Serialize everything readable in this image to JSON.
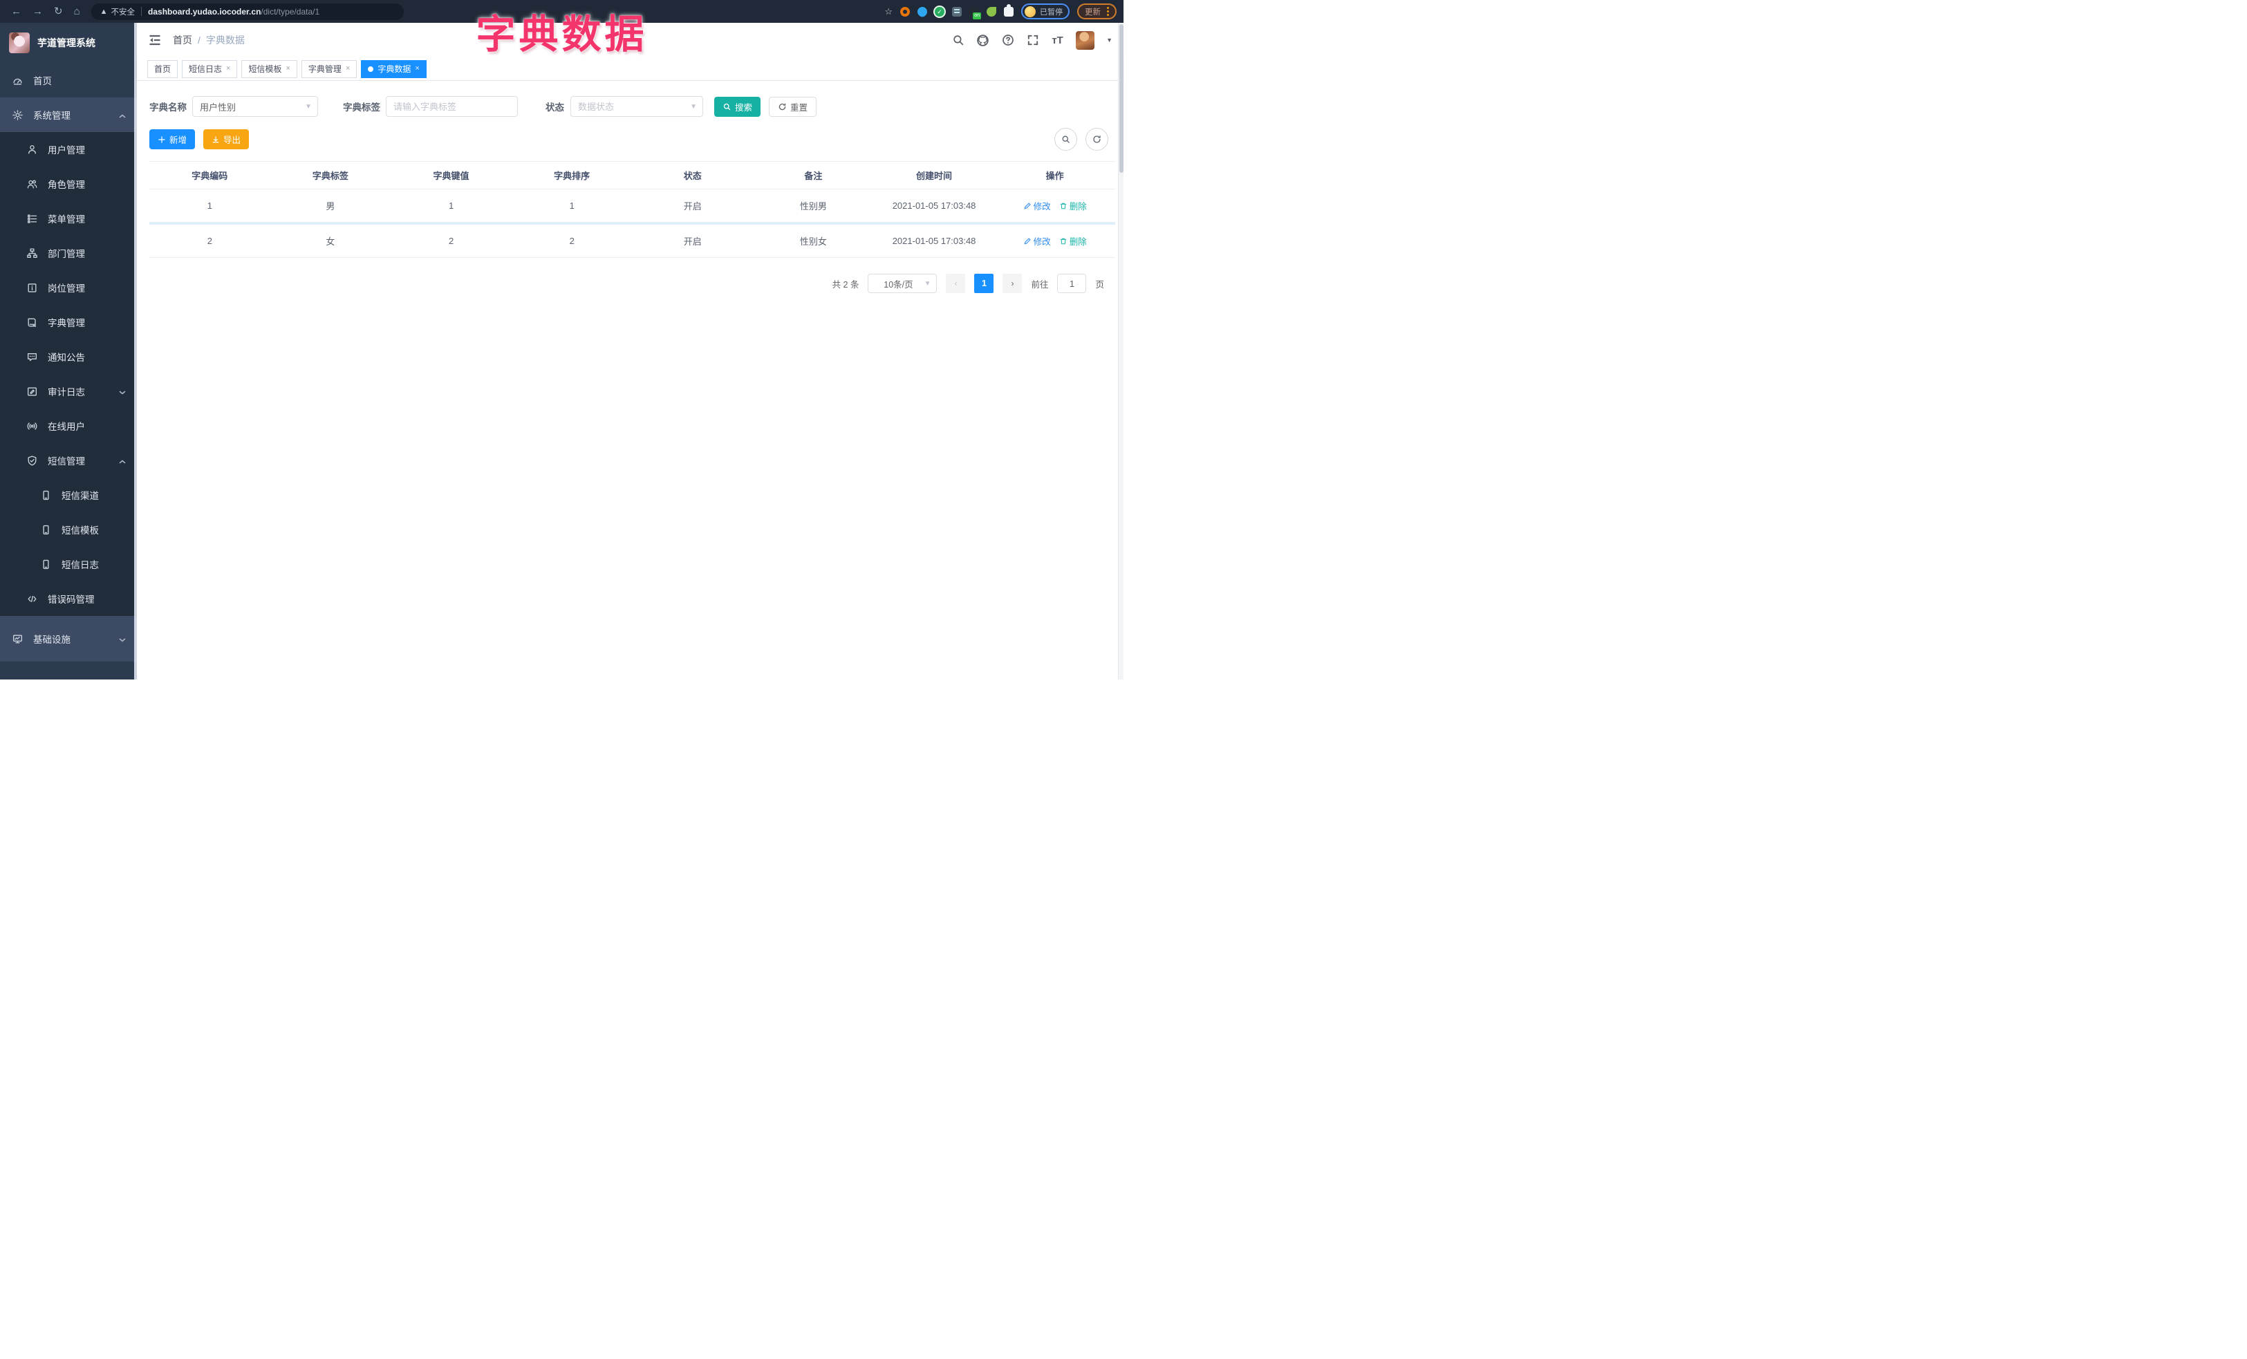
{
  "browser": {
    "security_label": "不安全",
    "url_host": "dashboard.yudao.iocoder.cn",
    "url_path": "/dict/type/data/1",
    "profile_chip": "已暂停",
    "update_button": "更新",
    "extension_on_badge": "on",
    "extensions": [
      "extension-orange-ring",
      "extension-blue-drop",
      "extension-green-check",
      "extension-blue-bars",
      "extension-on-badge",
      "extension-green-leaf",
      "extensions-puzzle-icon"
    ]
  },
  "overlay": {
    "title": "字典数据",
    "color": "#f4356b"
  },
  "sidebar": {
    "app_title": "芋道管理系统",
    "menu": [
      {
        "label": "首页",
        "icon": "dashboard-icon",
        "level": 1
      },
      {
        "label": "系统管理",
        "icon": "gear-icon",
        "level": 1,
        "chevron": "up",
        "highlight": true
      },
      {
        "label": "用户管理",
        "icon": "user-icon",
        "level": 2
      },
      {
        "label": "角色管理",
        "icon": "users-icon",
        "level": 2
      },
      {
        "label": "菜单管理",
        "icon": "menu-list-icon",
        "level": 2
      },
      {
        "label": "部门管理",
        "icon": "org-tree-icon",
        "level": 2
      },
      {
        "label": "岗位管理",
        "icon": "badge-icon",
        "level": 2
      },
      {
        "label": "字典管理",
        "icon": "dict-book-icon",
        "level": 2
      },
      {
        "label": "通知公告",
        "icon": "notice-icon",
        "level": 2
      },
      {
        "label": "审计日志",
        "icon": "audit-log-icon",
        "level": 2,
        "chevron": "down"
      },
      {
        "label": "在线用户",
        "icon": "online-user-icon",
        "level": 2
      },
      {
        "label": "短信管理",
        "icon": "shield-check-icon",
        "level": 2,
        "chevron": "up"
      },
      {
        "label": "短信渠道",
        "icon": "phone-icon",
        "level": 3
      },
      {
        "label": "短信模板",
        "icon": "phone-icon",
        "level": 3
      },
      {
        "label": "短信日志",
        "icon": "phone-icon",
        "level": 3
      },
      {
        "label": "错误码管理",
        "icon": "code-icon",
        "level": 2
      },
      {
        "label": "基础设施",
        "icon": "monitor-icon",
        "level": 1,
        "chevron": "down",
        "highlight": true,
        "grow": true
      }
    ]
  },
  "navbar": {
    "breadcrumb_first": "首页",
    "breadcrumb_sep": "/",
    "breadcrumb_last": "字典数据",
    "icons": [
      "search-icon",
      "github-icon",
      "help-icon",
      "fullscreen-icon",
      "font-size-icon"
    ]
  },
  "tabs": [
    {
      "label": "首页",
      "closable": false,
      "active": false
    },
    {
      "label": "短信日志",
      "closable": true,
      "active": false
    },
    {
      "label": "短信模板",
      "closable": true,
      "active": false
    },
    {
      "label": "字典管理",
      "closable": true,
      "active": false
    },
    {
      "label": "字典数据",
      "closable": true,
      "active": true
    }
  ],
  "filters": {
    "dict_name": {
      "label": "字典名称",
      "value": "用户性别"
    },
    "dict_label": {
      "label": "字典标签",
      "placeholder": "请输入字典标签"
    },
    "status": {
      "label": "状态",
      "placeholder": "数据状态"
    },
    "search_label": "搜索",
    "reset_label": "重置"
  },
  "toolbar": {
    "add_label": "新增",
    "export_label": "导出"
  },
  "table": {
    "headers": [
      "字典编码",
      "字典标签",
      "字典键值",
      "字典排序",
      "状态",
      "备注",
      "创建时间",
      "操作"
    ],
    "rows": [
      [
        "1",
        "男",
        "1",
        "1",
        "开启",
        "性别男",
        "2021-01-05 17:03:48"
      ],
      [
        "2",
        "女",
        "2",
        "2",
        "开启",
        "性别女",
        "2021-01-05 17:03:48"
      ]
    ],
    "actions": {
      "edit": "修改",
      "delete": "删除"
    }
  },
  "pagination": {
    "total_text": "共 2 条",
    "page_size": "10条/页",
    "current_page": "1",
    "goto_label": "前往",
    "goto_value": "1",
    "page_unit": "页"
  },
  "colors": {
    "primary_blue": "#1890ff",
    "teal": "#17b1a4",
    "orange": "#f7a511",
    "annotation_pink": "#f4356b",
    "sidebar_bg": "#2c3b50",
    "submenu_bg": "#222d3c"
  }
}
